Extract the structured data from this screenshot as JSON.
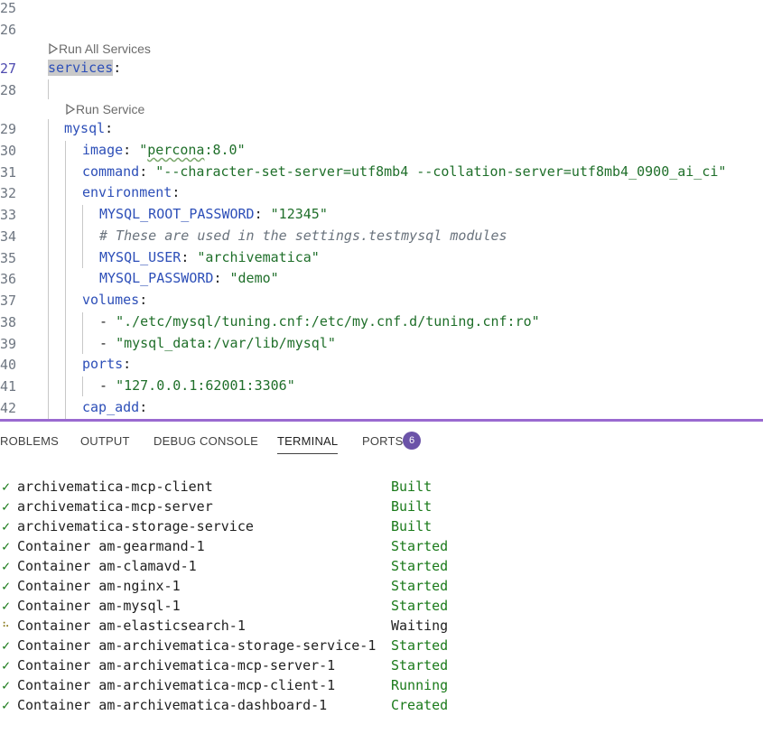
{
  "editor": {
    "code_lenses": {
      "run_all": "Run All Services",
      "run_service": "Run Service"
    },
    "lines": [
      {
        "num": "25"
      },
      {
        "num": "26"
      },
      {
        "num": "27",
        "key": "services",
        "colon": ":"
      },
      {
        "num": "28"
      },
      {
        "num": "29",
        "key": "mysql",
        "colon": ":"
      },
      {
        "num": "30",
        "key": "image",
        "colon": ": ",
        "q1": "\"",
        "val": "percona",
        "rest": ":8.0\""
      },
      {
        "num": "31",
        "key": "command",
        "colon": ": ",
        "val": "\"--character-set-server=utf8mb4 --collation-server=utf8mb4_0900_ai_ci\""
      },
      {
        "num": "32",
        "key": "environment",
        "colon": ":"
      },
      {
        "num": "33",
        "key": "MYSQL_ROOT_PASSWORD",
        "colon": ": ",
        "val": "\"12345\""
      },
      {
        "num": "34",
        "comment": "# These are used in the settings.testmysql modules"
      },
      {
        "num": "35",
        "key": "MYSQL_USER",
        "colon": ": ",
        "val": "\"archivematica\""
      },
      {
        "num": "36",
        "key": "MYSQL_PASSWORD",
        "colon": ": ",
        "val": "\"demo\""
      },
      {
        "num": "37",
        "key": "volumes",
        "colon": ":"
      },
      {
        "num": "38",
        "dash": "- ",
        "val": "\"./etc/mysql/tuning.cnf:/etc/my.cnf.d/tuning.cnf:ro\""
      },
      {
        "num": "39",
        "dash": "- ",
        "val": "\"mysql_data:/var/lib/mysql\""
      },
      {
        "num": "40",
        "key": "ports",
        "colon": ":"
      },
      {
        "num": "41",
        "dash": "- ",
        "val": "\"127.0.0.1:62001:3306\""
      },
      {
        "num": "42",
        "key": "cap_add",
        "colon": ":"
      }
    ]
  },
  "panel": {
    "tabs": [
      {
        "label": "ROBLEMS"
      },
      {
        "label": "OUTPUT"
      },
      {
        "label": "DEBUG CONSOLE"
      },
      {
        "label": "TERMINAL",
        "active": true
      },
      {
        "label": "PORTS"
      }
    ],
    "ports_badge": "6"
  },
  "terminal": {
    "rows": [
      {
        "mark": "✓",
        "name": "archivematica-mcp-client",
        "status": "Built"
      },
      {
        "mark": "✓",
        "name": "archivematica-mcp-server",
        "status": "Built"
      },
      {
        "mark": "✓",
        "name": "archivematica-storage-service",
        "status": "Built"
      },
      {
        "mark": "✓",
        "name": "Container am-gearmand-1",
        "status": "Started"
      },
      {
        "mark": "✓",
        "name": "Container am-clamavd-1",
        "status": "Started"
      },
      {
        "mark": "✓",
        "name": "Container am-nginx-1",
        "status": "Started"
      },
      {
        "mark": "✓",
        "name": "Container am-mysql-1",
        "status": "Started"
      },
      {
        "mark": "⠦",
        "name": "Container am-elasticsearch-1",
        "status": "Waiting"
      },
      {
        "mark": "✓",
        "name": "Container am-archivematica-storage-service-1",
        "status": "Started"
      },
      {
        "mark": "✓",
        "name": "Container am-archivematica-mcp-server-1",
        "status": "Started"
      },
      {
        "mark": "✓",
        "name": "Container am-archivematica-mcp-client-1",
        "status": "Running"
      },
      {
        "mark": "✓",
        "name": "Container am-archivematica-dashboard-1",
        "status": "Created"
      }
    ]
  },
  "colors": {
    "accent": "#9a6ad0",
    "badge": "#6b53a8",
    "status_green": "#1a7a1a",
    "yaml_key": "#2d4fb8",
    "yaml_string": "#1f6f2a"
  }
}
